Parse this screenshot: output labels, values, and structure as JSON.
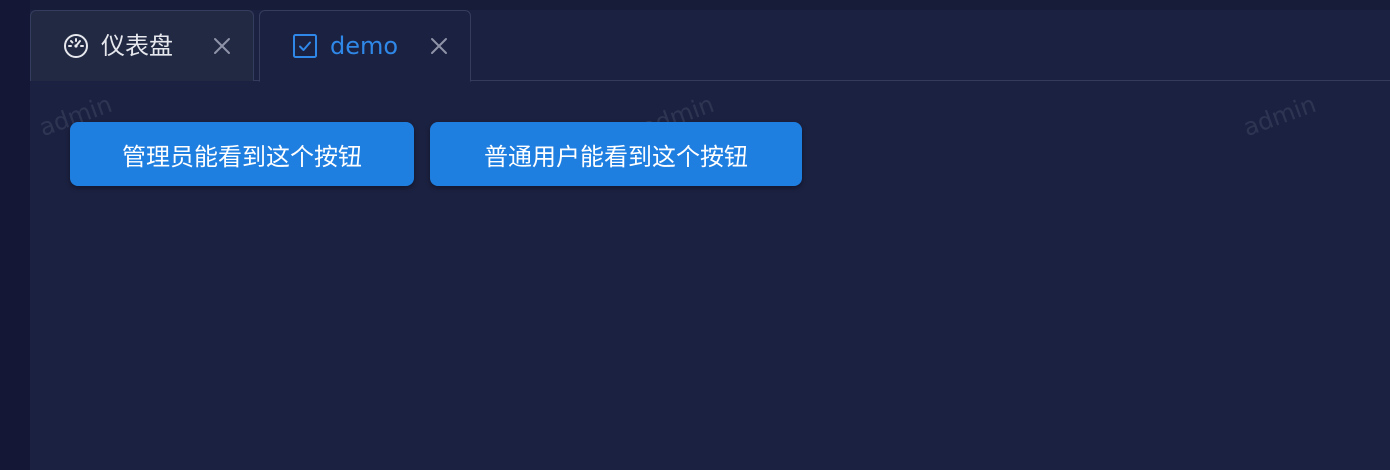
{
  "tabs": [
    {
      "label": "仪表盘",
      "icon": "dashboard-gauge-icon",
      "active": false
    },
    {
      "label": "demo",
      "icon": "checkbox-icon",
      "active": true
    }
  ],
  "buttons": {
    "admin_label": "管理员能看到这个按钮",
    "user_label": "普通用户能看到这个按钮"
  },
  "watermark": {
    "text": "admin"
  },
  "colors": {
    "primary": "#1f7fe1",
    "active_tab_text": "#2f88e8",
    "background": "#1b2140",
    "sidebar": "#141836"
  }
}
